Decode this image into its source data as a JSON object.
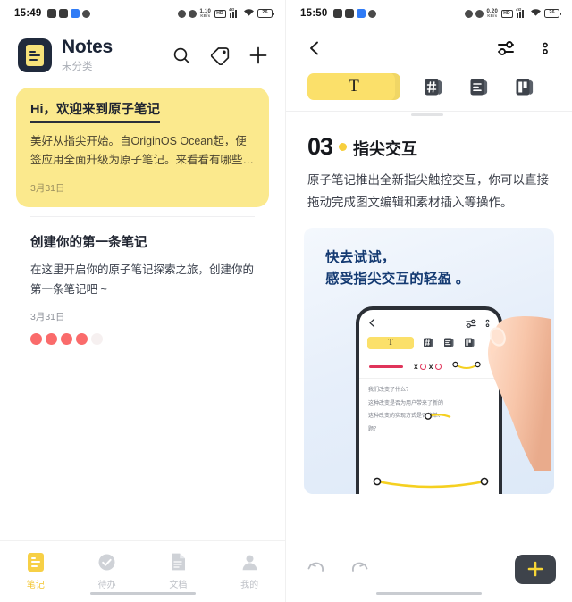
{
  "left": {
    "status": {
      "time": "15:49",
      "left_icons": [
        "app-icon-badge",
        "mail-icon",
        "calendar-icon",
        "dot-icon"
      ],
      "right_icons": [
        "alarm-icon",
        "mute-icon",
        "data-rate-icon",
        "hd-icon",
        "signal-4g-icon",
        "wifi-icon",
        "battery-icon"
      ],
      "data_rate": "1.10",
      "data_rate_unit": "KB/s",
      "hd_label": "HD",
      "network": "4G",
      "battery": "26"
    },
    "header": {
      "app_icon": "notes-app-icon",
      "title": "Notes",
      "subtitle": "未分类",
      "search_icon": "search-icon",
      "tag_icon": "tag-icon",
      "add_icon": "plus-icon"
    },
    "notes": [
      {
        "title": "Hi，欢迎来到原子笔记",
        "body": "美好从指尖开始。自OriginOS Ocean起，便签应用全面升级为原子笔记。来看看有哪些…",
        "date": "3月31日",
        "highlight": true
      },
      {
        "title": "创建你的第一条笔记",
        "body": "在这里开启你的原子笔记探索之旅，创建你的第一条笔记吧 ~",
        "date": "3月31日",
        "highlight": false,
        "dots": 4
      }
    ],
    "tabs": [
      {
        "label": "笔记",
        "icon": "note-icon",
        "active": true
      },
      {
        "label": "待办",
        "icon": "check-circle-icon",
        "active": false
      },
      {
        "label": "文档",
        "icon": "document-icon",
        "active": false
      },
      {
        "label": "我的",
        "icon": "person-icon",
        "active": false
      }
    ]
  },
  "right": {
    "status": {
      "time": "15:50",
      "data_rate": "0.20",
      "data_rate_unit": "KB/s",
      "hd_label": "HD",
      "network": "4G",
      "battery": "26"
    },
    "header": {
      "back_icon": "back-chevron-icon",
      "settings_icon": "sliders-icon",
      "more_icon": "more-vertical-icon"
    },
    "format_bar": [
      {
        "label": "T",
        "name": "text-format-button",
        "active": true
      },
      {
        "label": "",
        "name": "hashtag-format-button",
        "active": false
      },
      {
        "label": "",
        "name": "list-format-button",
        "active": false
      },
      {
        "label": "",
        "name": "layout-format-button",
        "active": false
      }
    ],
    "document": {
      "section_number": "03",
      "section_title": "指尖交互",
      "paragraph": "原子笔记推出全新指尖触控交互，你可以直接拖动完成图文编辑和素材插入等操作。"
    },
    "illustration": {
      "headline_line1": "快去试试，",
      "headline_line2": "感受指尖交互的轻盈 。",
      "phone": {
        "pill_label": "T",
        "text_lines": [
          "我们改变了什么？",
          "这种改变是否为用户带来了新的",
          "这种改变的实现方式是否简单、",
          "题？"
        ],
        "xo_marks": "x O x O"
      }
    },
    "footer": {
      "undo_icon": "undo-icon",
      "redo_icon": "redo-icon",
      "add_icon": "plus-icon"
    }
  },
  "colors": {
    "accent_yellow": "#fbe06a",
    "note_yellow": "#fbe98d",
    "dark_navy": "#202a3c",
    "dot_red": "#fa6b6b",
    "illus_blue": "#143a72"
  }
}
